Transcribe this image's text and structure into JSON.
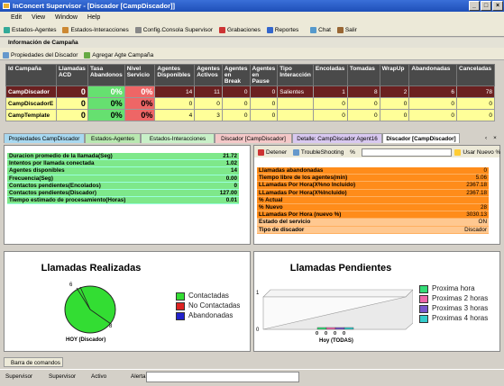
{
  "window": {
    "title": "InConcert Supervisor - [Discador [CampDiscador]]"
  },
  "menu": {
    "items": [
      "Edit",
      "View",
      "Window",
      "Help"
    ]
  },
  "toolbar": {
    "items": [
      "Estados-Agentes",
      "Estados-Interacciones",
      "Config.Consola Supervisor",
      "Grabaciones",
      "Reportes",
      "Chat",
      "Salir"
    ]
  },
  "section": {
    "title": "Información de Campaña"
  },
  "campaign_toolbar": {
    "props": "Propiedades del Discador",
    "add_agent": "Agregar Agte Campaña"
  },
  "table": {
    "headers": [
      "Id Campaña",
      "Llamadas ACD",
      "Tasa Abandonos",
      "Nivel Servicio",
      "Agentes Disponibles",
      "Agentes Activos",
      "Agentes en Break",
      "Agentes en Pause",
      "Tipo Interacción",
      "Encoladas",
      "Tomadas",
      "WrapUp",
      "Abandonadas",
      "Canceladas"
    ],
    "rows": [
      [
        "CampDiscador",
        "0",
        "0%",
        "0%",
        "14",
        "11",
        "0",
        "0",
        "Salientes",
        "1",
        "8",
        "2",
        "6",
        "78"
      ],
      [
        "CampDiscadorE",
        "0",
        "0%",
        "0%",
        "0",
        "0",
        "0",
        "0",
        "",
        "0",
        "0",
        "0",
        "0",
        "0"
      ],
      [
        "CampTemplate",
        "0",
        "0%",
        "0%",
        "4",
        "3",
        "0",
        "0",
        "",
        "0",
        "0",
        "0",
        "0",
        "0"
      ]
    ]
  },
  "tabs": [
    "Propiedades CampDiscador",
    "Estados-Agentes",
    "Estados-Interacciones",
    "Discador [CampDiscador]",
    "Detalle: CampDiscador Agent16",
    "Discador [CampDiscador]"
  ],
  "left_stats": [
    {
      "label": "Duracion promedio de la llamada(Seg)",
      "value": "21.72"
    },
    {
      "label": "Intentos por llamada conectada",
      "value": "1.02"
    },
    {
      "label": "Agentes disponibles",
      "value": "14"
    },
    {
      "label": "Frecuencia(Seg)",
      "value": "0.00"
    },
    {
      "label": "Contactos pendientes(Encolados)",
      "value": "0"
    },
    {
      "label": "Contactos pendientes(Discador)",
      "value": "127.00"
    },
    {
      "label": "Tiempo estimado de procesamiento(Horas)",
      "value": "0.01"
    }
  ],
  "right_toolbar": {
    "stop": "Detener",
    "troubleshoot": "TroubleShooting",
    "pct": "%",
    "new_pct": "Usar Nuevo %"
  },
  "right_stats": [
    {
      "label": "Llamadas abandonadas",
      "value": "0"
    },
    {
      "label": "Tiempo libre de los agentes(min)",
      "value": "5.06"
    },
    {
      "label": "LLamadas Por Hora(X%no Incluido)",
      "value": "2367.18"
    },
    {
      "label": "LLamadas Por Hora(X%Incluido)",
      "value": "2367.18"
    },
    {
      "label": "% Actual",
      "value": ""
    },
    {
      "label": "% Nuevo",
      "value": "28"
    },
    {
      "label": "LLamadas Por Hora (nuevo %)",
      "value": "3030.13"
    },
    {
      "label": "Estado del servicio",
      "value": "ON"
    },
    {
      "label": "Tipo de discador",
      "value": "Discador"
    }
  ],
  "chart_realizadas": {
    "title": "Llamadas Realizadas",
    "caption": "HOY (Discador)",
    "legend": [
      "Contactadas",
      "No Contactadas",
      "Abandonadas"
    ],
    "colors": [
      "#33dd33",
      "#dd2222",
      "#2222cc"
    ]
  },
  "chart_pendientes": {
    "title": "Llamadas Pendientes",
    "caption": "Hoy (TODAS)",
    "legend": [
      "Proxima hora",
      "Proximas 2 horas",
      "Proximas 3 horas",
      "Proximas 4 horas"
    ],
    "colors": [
      "#33dd77",
      "#ee66aa",
      "#7755cc",
      "#33cccc"
    ],
    "yticks": [
      "1",
      "0"
    ],
    "bar_values": [
      "0",
      "0",
      "0",
      "0"
    ]
  },
  "cmdbar": {
    "title": "Barra de comandos"
  },
  "status": {
    "items": [
      "Supervisor",
      "Supervisor",
      "Activo",
      "Alerta"
    ]
  }
}
